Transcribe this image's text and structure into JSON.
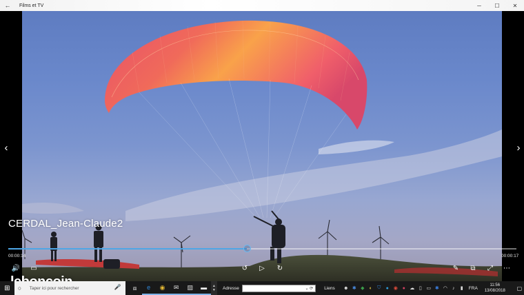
{
  "window": {
    "title": "Films et TV",
    "back_icon": "←",
    "minimize_icon": "─",
    "maximize_icon": "☐",
    "close_icon": "✕"
  },
  "player": {
    "video_title": "CERDAL_Jean-Claude2",
    "time_current": "00:00:14",
    "time_total": "00:00:17",
    "progress": 0.47,
    "prev_icon": "‹",
    "next_icon": "›",
    "controls": {
      "volume": "🔊",
      "subtitles": "▭",
      "rewind": "↺",
      "play": "▷",
      "forward": "↻",
      "edit": "✎",
      "cast": "⧉",
      "fullscreen": "⤢",
      "more": "⋯"
    }
  },
  "watermark": {
    "text": "leboncoin"
  },
  "taskbar": {
    "start_icon": "⊞",
    "search_icon": "○",
    "search_placeholder": "Taper ici pour rechercher",
    "mic_icon": "🎤",
    "address_label": "Adresse",
    "address_dropdown": "⌄ ⟳",
    "links_label": "Liens",
    "lang": "FRA",
    "time": "11:56",
    "date": "13/08/2018",
    "notification_icon": "▢",
    "apps": [
      {
        "name": "task-view-icon",
        "glyph": "⧈",
        "color": "#dddddd"
      },
      {
        "name": "edge-icon",
        "glyph": "e",
        "color": "#2f87d8"
      },
      {
        "name": "chrome-icon",
        "glyph": "◉",
        "color": "#e5b935"
      },
      {
        "name": "mail-icon",
        "glyph": "✉",
        "color": "#dddddd"
      },
      {
        "name": "photos-icon",
        "glyph": "▨",
        "color": "#cccccc"
      },
      {
        "name": "films-tv-icon",
        "glyph": "▬",
        "color": "#eeeeee"
      }
    ],
    "tray": [
      {
        "name": "people-icon",
        "glyph": "☻",
        "color": "#dddddd"
      },
      {
        "name": "bluetooth-icon",
        "glyph": "✱",
        "color": "#4a8be0"
      },
      {
        "name": "network-icon",
        "glyph": "◆",
        "color": "#3b9c4a"
      },
      {
        "name": "security-icon",
        "glyph": "◐",
        "color": "#e0c040"
      },
      {
        "name": "shield-icon",
        "glyph": "⛉",
        "color": "#2f7fd0"
      },
      {
        "name": "app-tray-icon",
        "glyph": "●",
        "color": "#2f9bd8"
      },
      {
        "name": "chrome-tray-icon",
        "glyph": "◉",
        "color": "#e04c3c"
      },
      {
        "name": "tray-app-icon",
        "glyph": "●",
        "color": "#d04060"
      },
      {
        "name": "onedrive-icon",
        "glyph": "☁",
        "color": "#dddddd"
      },
      {
        "name": "usb-icon",
        "glyph": "▯",
        "color": "#dddddd"
      },
      {
        "name": "display-icon",
        "glyph": "▭",
        "color": "#dddddd"
      },
      {
        "name": "tray-blue-icon",
        "glyph": "✱",
        "color": "#3b7fe0"
      },
      {
        "name": "wifi-icon",
        "glyph": "◠",
        "color": "#dddddd"
      },
      {
        "name": "volume-tray-icon",
        "glyph": "♪",
        "color": "#dddddd"
      },
      {
        "name": "power-icon",
        "glyph": "▮",
        "color": "#dddddd"
      }
    ]
  }
}
